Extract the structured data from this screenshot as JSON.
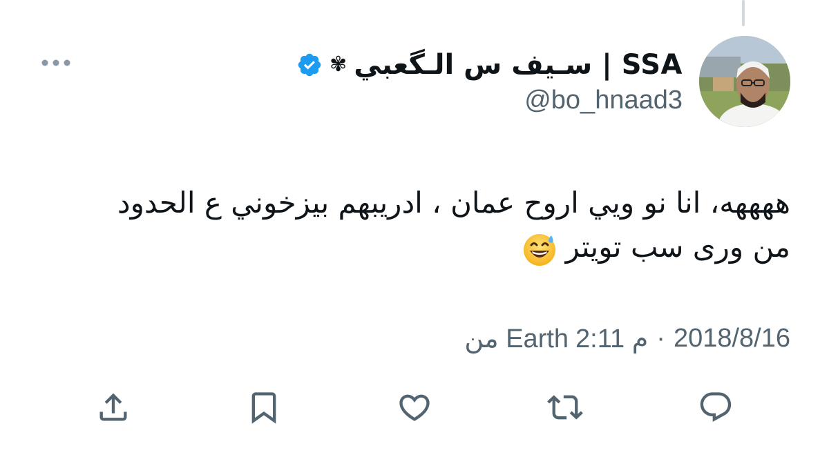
{
  "tweet": {
    "display_name": "سـيف س الـگعبي | SSA",
    "name_ornament": "✾",
    "handle": "@bo_hnaad3",
    "body_lines": [
      "ههههه، انا نو ويي اروح عمان ، ادريبهم بيزخوني ع الحدود",
      "من ورى سب تويتر"
    ],
    "emoji": "grinning-face-with-sweat-emoji",
    "meta": {
      "date": "2018/8/16",
      "separator": "·",
      "time": "2:11 م",
      "source": "من Earth"
    }
  },
  "icons": {
    "more": "more-horizontal-icon",
    "verified": "verified-badge-icon",
    "share": "share-icon",
    "bookmark": "bookmark-icon",
    "like": "heart-icon",
    "retweet": "retweet-icon",
    "reply": "reply-icon"
  },
  "colors": {
    "text": "#0f1419",
    "secondary": "#536471",
    "verified": "#1d9bf0",
    "thread_line": "#cfd9de",
    "background": "#ffffff"
  }
}
